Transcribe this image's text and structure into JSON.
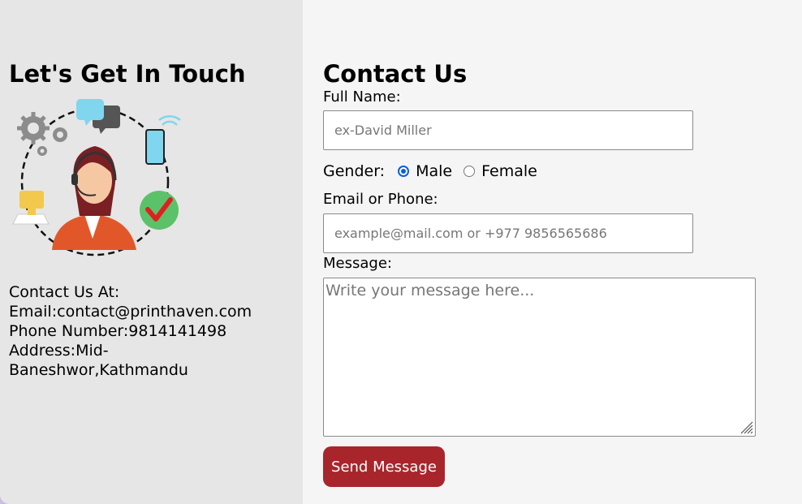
{
  "left": {
    "heading": "Let's Get In Touch",
    "illustration_icon": "customer-support-agent-icon",
    "contact": {
      "title": "Contact Us At:",
      "email_label": "Email:",
      "email": "contact@printhaven.com",
      "phone_label": "Phone Number:",
      "phone": "9814141498",
      "address_label": "Address:",
      "address": "Mid-Baneshwor,Kathmandu"
    }
  },
  "form": {
    "heading": "Contact Us",
    "full_name_label": "Full Name:",
    "full_name_placeholder": "ex-David Miller",
    "gender_label": "Gender:",
    "gender_options": [
      "Male",
      "Female"
    ],
    "gender_selected": "Male",
    "email_phone_label": "Email or Phone:",
    "email_phone_placeholder": "example@mail.com or +977 9856565686",
    "message_label": "Message:",
    "message_placeholder": "Write your message here...",
    "submit_label": "Send Message"
  },
  "colors": {
    "left_bg": "#e6e6e6",
    "right_bg": "#f5f5f5",
    "button_bg": "#a8262b",
    "radio_accent": "#0b5fd8"
  }
}
